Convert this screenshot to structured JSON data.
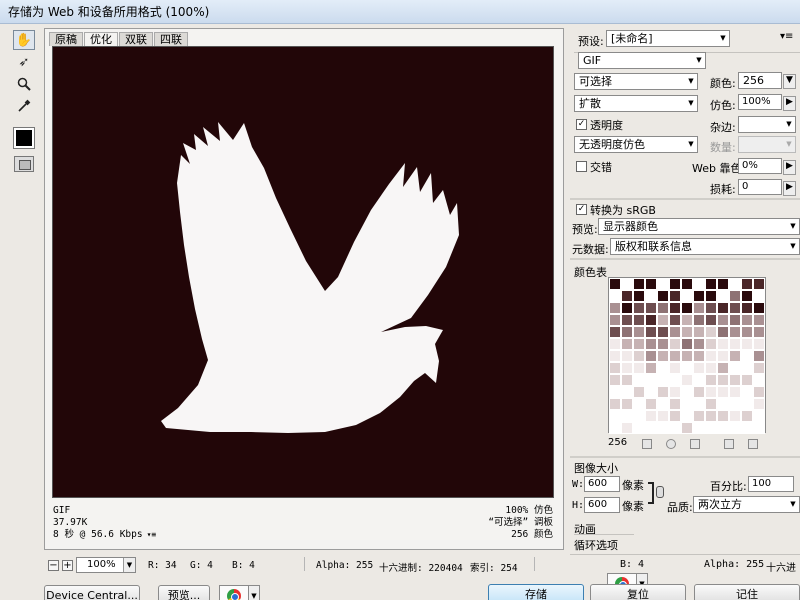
{
  "window": {
    "title": "存储为 Web 和设备所用格式 (100%)"
  },
  "tools": [
    {
      "name": "hand-tool-icon",
      "glyph": "✋"
    },
    {
      "name": "slice-select-tool-icon",
      "glyph": "➶"
    },
    {
      "name": "zoom-tool-icon",
      "glyph": "🔍"
    },
    {
      "name": "eyedropper-tool-icon",
      "glyph": "✎"
    }
  ],
  "tabs": [
    "原稿",
    "优化",
    "双联",
    "四联"
  ],
  "image_info": {
    "format": "GIF",
    "size": "37.97K",
    "time": "8 秒 @ 56.6 Kbps",
    "dither": "100% 仿色",
    "palette": "“可选择” 调板",
    "colors": "256 颜色"
  },
  "statusbar": {
    "minus": "−",
    "plus": "+",
    "zoom": "100%",
    "r": "R: 34",
    "g": "G: 4",
    "b": "B: 4",
    "alpha": "Alpha: 255",
    "hex": "十六进制: 220404",
    "index": "索引: 254"
  },
  "buttons": {
    "device_central": "Device Central...",
    "preview": "预览...",
    "save": "存储",
    "reset": "复位",
    "remember": "记住"
  },
  "settings": {
    "preset_label": "预设:",
    "preset_value": "[未命名]",
    "format": "GIF",
    "reduction": "可选择",
    "dither_algo": "扩散",
    "transparency_label": "透明度",
    "transparency_dither": "无透明度仿色",
    "interlaced_label": "交错",
    "colors_label": "颜色:",
    "colors_value": "256",
    "dither_label": "仿色:",
    "dither_value": "100%",
    "matte_label": "杂边:",
    "amount_label": "数量:",
    "web_snap_label": "Web 靠色:",
    "web_snap_value": "0%",
    "lossy_label": "损耗:",
    "lossy_value": "0",
    "convert_srgb_label": "转换为 sRGB",
    "preview_label": "预览:",
    "preview_value": "显示器颜色",
    "metadata_label": "元数据:",
    "metadata_value": "版权和联系信息"
  },
  "color_table": {
    "header": "颜色表",
    "count": "256"
  },
  "image_size": {
    "header": "图像大小",
    "w_label": "W:",
    "w_value": "600",
    "h_label": "H:",
    "h_value": "600",
    "unit": "像素",
    "percent_label": "百分比:",
    "percent_value": "100",
    "quality_label": "品质:",
    "quality_value": "两次立方"
  },
  "animation": {
    "header": "动画",
    "loop_label": "循环选项"
  },
  "colors": {
    "canvas_bg": "#220608",
    "dove": "#f8f6f6"
  }
}
